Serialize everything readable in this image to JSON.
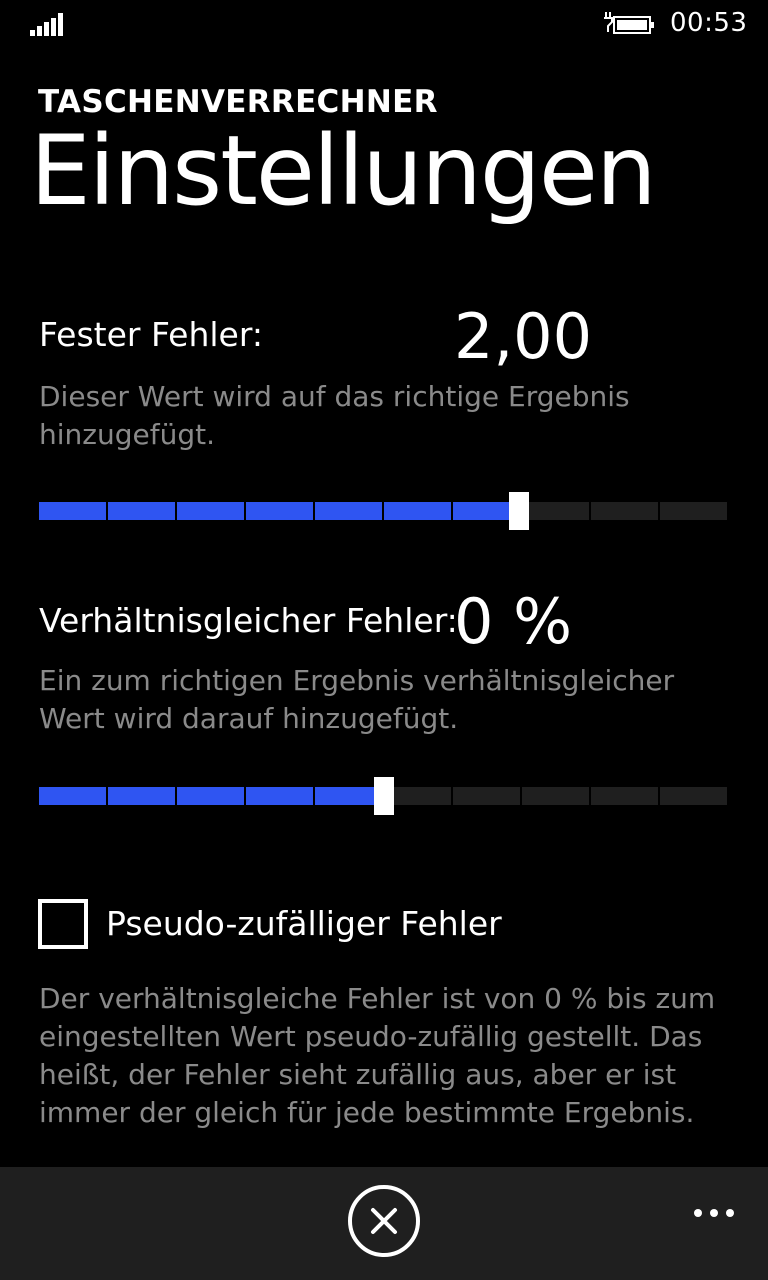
{
  "status_bar": {
    "time": "00:53",
    "icons": [
      "signal-icon",
      "battery-charging-icon"
    ]
  },
  "header": {
    "app_title": "TASCHENVERRECHNER",
    "page_title": "Einstellungen"
  },
  "fixed_error": {
    "label": "Fester Fehler:",
    "value": "2,00",
    "description": "Dieser Wert wird auf das richtige Ergebnis hinzugefügt.",
    "slider_fraction": 0.695
  },
  "proportional_error": {
    "label": "Verhältnisgleicher Fehler:",
    "value": "0 %",
    "description": "Ein zum richtigen Ergebnis verhältnisgleicher Wert wird darauf hinzugefügt.",
    "slider_fraction": 0.5
  },
  "pseudo_random": {
    "label": "Pseudo-zufälliger Fehler",
    "checked": false,
    "description": "Der verhältnisgleiche Fehler ist von 0 % bis zum eingestellten Wert pseudo-zufällig gestellt. Das heißt, der Fehler sieht zufällig aus, aber er ist immer der gleich für jede bestimmte Ergebnis."
  },
  "app_bar": {
    "icons": [
      "cancel-icon",
      "more-icon"
    ]
  },
  "colors": {
    "accent": "#2f55f2",
    "background": "#000000",
    "secondary_text": "#8a8a8a",
    "app_bar": "#1f1f1f"
  }
}
